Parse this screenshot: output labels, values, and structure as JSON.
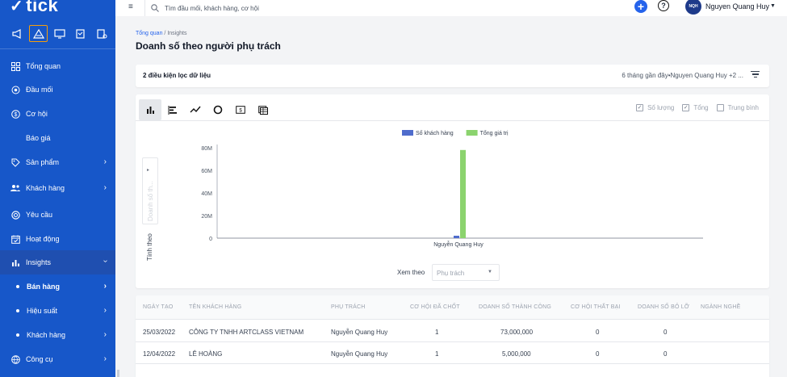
{
  "app": {
    "logo_text": "tick"
  },
  "topbar": {
    "search_placeholder": "Tìm đầu mối, khách hàng, cơ hội",
    "user_initials": "NQH",
    "user_name": "Nguyen Quang Huy"
  },
  "sidebar": {
    "items": [
      {
        "label": "Tổng quan",
        "icon": "dashboard-icon"
      },
      {
        "label": "Đầu mối",
        "icon": "target-icon"
      },
      {
        "label": "Cơ hội",
        "icon": "dollar-icon"
      },
      {
        "label": "Báo giá",
        "icon": "document-icon"
      },
      {
        "label": "Sản phẩm",
        "icon": "tag-icon"
      },
      {
        "label": "Khách hàng",
        "icon": "users-icon"
      },
      {
        "label": "Yêu cầu",
        "icon": "lifebuoy-icon"
      },
      {
        "label": "Hoạt động",
        "icon": "calendar-icon"
      },
      {
        "label": "Insights",
        "icon": "bar-chart-icon"
      },
      {
        "label": "Bán hàng"
      },
      {
        "label": "Hiệu suất"
      },
      {
        "label": "Khách hàng"
      },
      {
        "label": "Công cụ",
        "icon": "globe-icon"
      }
    ]
  },
  "page": {
    "breadcrumb_root": "Tổng quan",
    "breadcrumb_sep": " / ",
    "breadcrumb_current": "Insights",
    "title": "Doanh số theo người phụ trách"
  },
  "filter": {
    "count_label": "2 điều kiện lọc dữ liệu",
    "summary": "6 tháng gần đây•Nguyen Quang Huy +2 ..."
  },
  "chart_options": {
    "checks": [
      {
        "label": "Số lượng",
        "checked": true
      },
      {
        "label": "Tổng",
        "checked": true
      },
      {
        "label": "Trung bình",
        "checked": false
      }
    ],
    "tinh_theo_label": "Tính theo",
    "tinh_theo_value": "Doanh số th...",
    "xem_theo_label": "Xem theo",
    "xem_theo_value": "Phụ trách"
  },
  "chart_data": {
    "type": "bar",
    "categories": [
      "Nguyễn Quang Huy"
    ],
    "series": [
      {
        "name": "Số khách hàng",
        "values": [
          2
        ],
        "color": "#4f6ccc"
      },
      {
        "name": "Tổng giá trị",
        "values": [
          78000000
        ],
        "color": "#8bd36e"
      }
    ],
    "y_ticks": [
      "80M",
      "60M",
      "40M",
      "20M",
      "0"
    ],
    "ylim": [
      0,
      80000000
    ],
    "legend_position": "top-center",
    "grid": false
  },
  "table": {
    "headers": [
      "NGÀY TẠO",
      "TÊN KHÁCH HÀNG",
      "PHỤ TRÁCH",
      "CƠ HỘI ĐÃ CHỐT",
      "DOANH SỐ THÀNH CÔNG",
      "CƠ HỘI THẤT BẠI",
      "DOANH SỐ BỎ LỠ",
      "NGÀNH NGHỀ"
    ],
    "rows": [
      [
        "25/03/2022",
        "CÔNG TY TNHH ARTCLASS VIETNAM",
        "Nguyễn Quang Huy",
        "1",
        "73,000,000",
        "0",
        "0",
        ""
      ],
      [
        "12/04/2022",
        "LÊ HOÀNG",
        "Nguyễn Quang Huy",
        "1",
        "5,000,000",
        "0",
        "0",
        ""
      ]
    ]
  }
}
